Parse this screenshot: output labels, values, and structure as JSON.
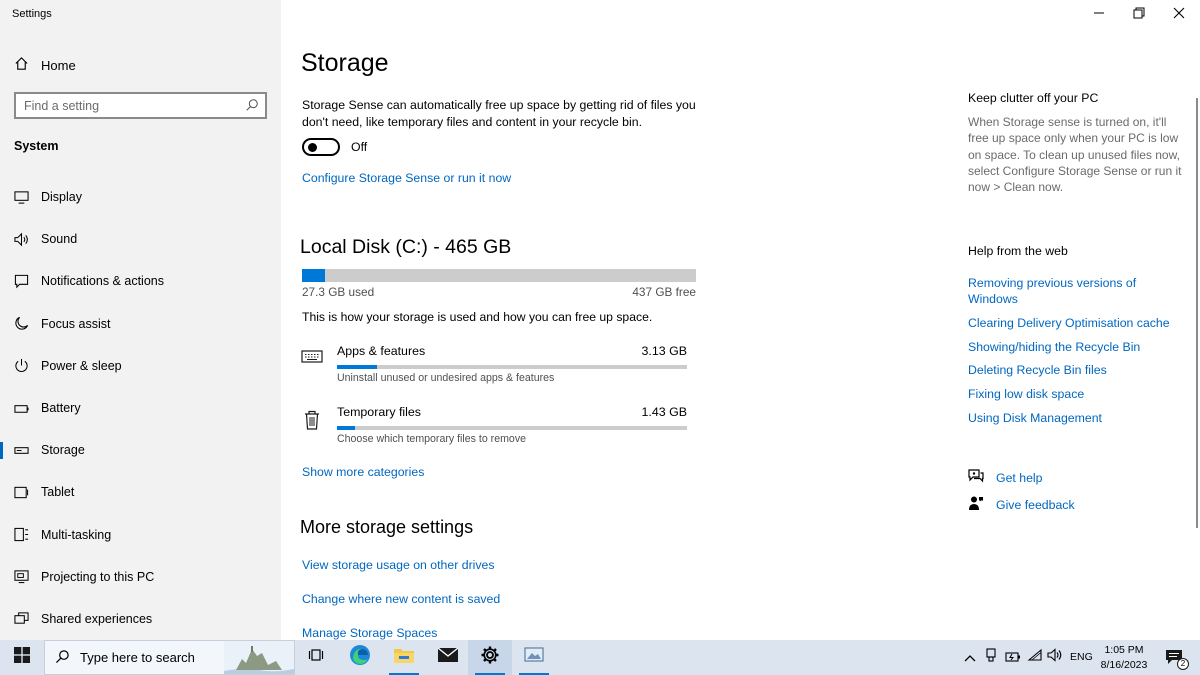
{
  "window": {
    "title": "Settings",
    "controls": [
      "minimize-icon",
      "restore-icon",
      "close-icon"
    ]
  },
  "sidebar": {
    "home_label": "Home",
    "search_placeholder": "Find a setting",
    "section_label": "System",
    "items": [
      {
        "label": "Display",
        "icon": "display-icon"
      },
      {
        "label": "Sound",
        "icon": "speaker-icon"
      },
      {
        "label": "Notifications & actions",
        "icon": "message-icon"
      },
      {
        "label": "Focus assist",
        "icon": "moon-icon"
      },
      {
        "label": "Power & sleep",
        "icon": "power-icon"
      },
      {
        "label": "Battery",
        "icon": "battery-icon"
      },
      {
        "label": "Storage",
        "icon": "drive-icon",
        "active": true
      },
      {
        "label": "Tablet",
        "icon": "tablet-icon"
      },
      {
        "label": "Multi-tasking",
        "icon": "multitask-icon"
      },
      {
        "label": "Projecting to this PC",
        "icon": "project-icon"
      },
      {
        "label": "Shared experiences",
        "icon": "share-icon"
      }
    ]
  },
  "main": {
    "title": "Storage",
    "description": "Storage Sense can automatically free up space by getting rid of files you don't need, like temporary files and content in your recycle bin.",
    "toggle_state": "Off",
    "configure_link": "Configure Storage Sense or run it now",
    "disk": {
      "title": "Local Disk (C:) - 465 GB",
      "used_label": "27.3 GB used",
      "free_label": "437 GB free",
      "used_fraction": 0.059
    },
    "how_text": "This is how your storage is used and how you can free up space.",
    "categories": [
      {
        "name": "Apps & features",
        "size": "3.13 GB",
        "subtitle": "Uninstall unused or undesired apps & features",
        "fill_fraction": 0.115,
        "icon": "keyboard-icon"
      },
      {
        "name": "Temporary files",
        "size": "1.43 GB",
        "subtitle": "Choose which temporary files to remove",
        "fill_fraction": 0.05,
        "icon": "trash-icon"
      }
    ],
    "show_more_link": "Show more categories",
    "more_settings_title": "More storage settings",
    "more_links": [
      "View storage usage on other drives",
      "Change where new content is saved",
      "Manage Storage Spaces"
    ]
  },
  "right_panel": {
    "clutter_title": "Keep clutter off your PC",
    "clutter_text": "When Storage sense is turned on, it'll free up space only when your PC is low on space. To clean up unused files now, select Configure Storage Sense or run it now > Clean now.",
    "help_title": "Help from the web",
    "help_links": [
      "Removing previous versions of Windows",
      "Clearing Delivery Optimisation cache",
      "Showing/hiding the Recycle Bin",
      "Deleting Recycle Bin files",
      "Fixing low disk space",
      "Using Disk Management"
    ],
    "get_help": "Get help",
    "give_feedback": "Give feedback"
  },
  "taskbar": {
    "search_placeholder": "Type here to search",
    "apps": [
      "task-view-icon",
      "edge-icon",
      "file-explorer-icon",
      "mail-icon",
      "settings-icon",
      "photos-icon"
    ],
    "lang": "ENG",
    "time": "1:05 PM",
    "date": "8/16/2023",
    "notification_count": "2",
    "colors": {
      "accent": "#0078d7",
      "link": "#0067c0",
      "taskbar_bg": "#dce4f0"
    }
  }
}
